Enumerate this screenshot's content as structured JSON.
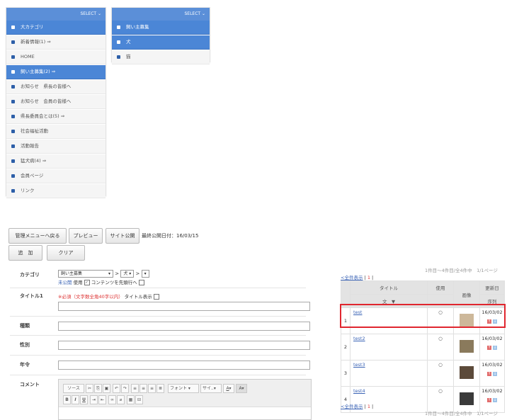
{
  "left_panel": {
    "header": "SELECT ⌄",
    "items": [
      {
        "label": "大カテゴリ",
        "active": true
      },
      {
        "label": "新着情報(1) ⇒",
        "active": false
      },
      {
        "label": "HOME",
        "active": false
      },
      {
        "label": "飼い主募集(2) ⇒",
        "active": true
      },
      {
        "label": "お知らせ　県長の皆様へ",
        "active": false
      },
      {
        "label": "お知らせ　会員の皆様へ",
        "active": false
      },
      {
        "label": "県長委員会とは(5) ⇒",
        "active": false
      },
      {
        "label": "社会福祉活動",
        "active": false
      },
      {
        "label": "活動報告",
        "active": false
      },
      {
        "label": "猛犬病(4) ⇒",
        "active": false
      },
      {
        "label": "会員ページ",
        "active": false
      },
      {
        "label": "リンク",
        "active": false
      }
    ]
  },
  "right_panel": {
    "header": "SELECT ⌄",
    "items": [
      {
        "label": "飼い主募集",
        "active": true
      },
      {
        "label": "犬",
        "active": true
      },
      {
        "label": "猫",
        "active": false
      }
    ]
  },
  "toolbar": {
    "back_label": "管理メニューへ戻る",
    "preview_label": "プレビュー",
    "publish_label": "サイト公開",
    "last_published": "最終公開日付：16/03/15",
    "add_label": "追　加",
    "clear_label": "クリア"
  },
  "form": {
    "category_label": "カテゴリ",
    "category_select1": "飼い主募集",
    "category_select2": "犬",
    "category_select3": "",
    "category_note_unpublished": "未公開",
    "category_note_use": "使用",
    "category_note_top": "コンテンツを先頭行へ",
    "title1_label": "タイトル1",
    "title1_hint": "※必須（文字数全角40字以内）",
    "title1_hide": "タイトル表示",
    "type_label": "種類",
    "sex_label": "性別",
    "age_label": "年令",
    "comment_label": "コメント",
    "editor": {
      "source": "ソース",
      "font": "フォント",
      "size": "サイ.."
    }
  },
  "list": {
    "summary": "1件目〜4件目/全4件中　1/1ページ",
    "show_all": "<全件表示",
    "page_sep": "|",
    "page_current": "1",
    "columns": {
      "title": "タイトル",
      "use": "使用",
      "image": "画像",
      "updated": "更新日",
      "order": "序列",
      "sort_asc": "文",
      "sort_desc": "▼"
    },
    "rows": [
      {
        "no": "1",
        "title": "test",
        "use": "○",
        "date": "16/03/02",
        "selected": true
      },
      {
        "no": "2",
        "title": "test2",
        "use": "○",
        "date": "16/03/02",
        "selected": false
      },
      {
        "no": "3",
        "title": "test3",
        "use": "○",
        "date": "16/03/02",
        "selected": false
      },
      {
        "no": "4",
        "title": "test4",
        "use": "○",
        "date": "16/03/02",
        "selected": false
      }
    ],
    "up_symbol": "↑",
    "down_symbol": "↓"
  },
  "colors": {
    "accent": "#4b86d6",
    "highlight": "#e0262f"
  }
}
